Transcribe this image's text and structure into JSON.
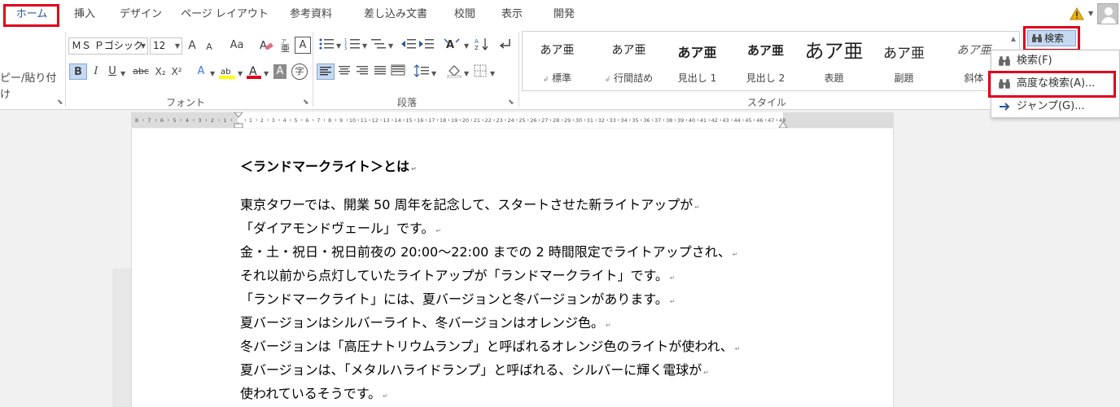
{
  "tabs": [
    {
      "label": "ホーム",
      "active": true
    },
    {
      "label": "挿入"
    },
    {
      "label": "デザイン"
    },
    {
      "label": "ページ レイアウト"
    },
    {
      "label": "参考資料"
    },
    {
      "label": "差し込み文書"
    },
    {
      "label": "校閲"
    },
    {
      "label": "表示"
    },
    {
      "label": "開発"
    }
  ],
  "clipboard": {
    "paste_label": "ピー/貼り付け"
  },
  "font": {
    "name": "ＭＳ Ｐゴシック",
    "size": "12",
    "group_label": "フォント",
    "aa_label": "Aa",
    "bold": "B",
    "italic": "I",
    "underline": "U",
    "strike": "abc",
    "subscript": "X₂",
    "superscript": "X²",
    "grow": "A",
    "shrink": "A",
    "color_a": "A",
    "shade_a": "A",
    "enclosed": "字"
  },
  "paragraph": {
    "group_label": "段落"
  },
  "styles": {
    "group_label": "スタイル",
    "items": [
      {
        "preview": "あア亜",
        "name": "標準",
        "mark": "↲"
      },
      {
        "preview": "あア亜",
        "name": "行間詰め",
        "mark": "↲"
      },
      {
        "preview": "あア亜",
        "name": "見出し 1",
        "mark": ""
      },
      {
        "preview": "あア亜",
        "name": "見出し 2",
        "mark": ""
      },
      {
        "preview": "あア亜",
        "name": "表題",
        "mark": ""
      },
      {
        "preview": "あア亜",
        "name": "副題",
        "mark": ""
      },
      {
        "preview": "あア亜",
        "name": "斜体",
        "mark": ""
      }
    ]
  },
  "search": {
    "button_label": "検索",
    "menu": [
      {
        "label": "検索(F)"
      },
      {
        "label": "高度な検索(A)..."
      },
      {
        "label": "ジャンプ(G)..."
      }
    ]
  },
  "ruler": {
    "left_numbers": [
      "8",
      "7",
      "6",
      "5",
      "4",
      "3",
      "2",
      "1"
    ],
    "right_numbers": [
      "1",
      "2",
      "3",
      "4",
      "5",
      "6",
      "7",
      "8",
      "9",
      "10",
      "11",
      "12",
      "13",
      "14",
      "15",
      "16",
      "17",
      "18",
      "19",
      "20",
      "21",
      "22",
      "23",
      "24",
      "25",
      "26",
      "27",
      "28",
      "29",
      "30",
      "31",
      "32",
      "33",
      "34",
      "35",
      "36",
      "37",
      "38",
      "39",
      "40",
      "41",
      "42",
      "43",
      "44",
      "45",
      "46",
      "47",
      "48"
    ]
  },
  "document": {
    "heading": "＜ランドマークライト＞とは",
    "lines": [
      "東京タワーでは、開業 50 周年を記念して、スタートさせた新ライトアップが",
      "「ダイアモンドヴェール」です。",
      "金・土・祝日・祝日前夜の 20:00～22:00 までの 2 時間限定でライトアップされ、",
      "それ以前から点灯していたライトアップが「ランドマークライト」です。",
      "「ランドマークライト」には、夏バージョンと冬バージョンがあります。",
      "夏バージョンはシルバーライト、冬バージョンはオレンジ色。",
      "冬バージョンは「高圧ナトリウムランプ」と呼ばれるオレンジ色のライトが使われ、",
      "夏バージョンは、「メタルハライドランプ」と呼ばれる、シルバーに輝く電球が",
      "使われているそうです。"
    ]
  },
  "colors": {
    "highlight_red": "#e0001b",
    "accent": "#2b579a",
    "selected_fill": "#c5d9f1"
  }
}
